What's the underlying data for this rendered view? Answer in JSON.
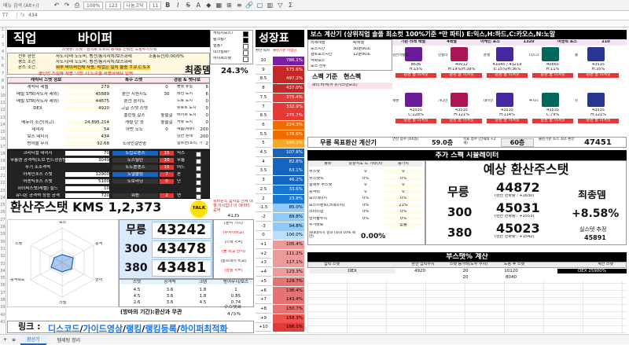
{
  "toolbar": {
    "search": "메뉴 검색 (Alt+/)",
    "zoom": "100%",
    "font": "나눔고딕",
    "size": "11",
    "fmt": "123",
    "undo": "↶",
    "redo": "↷"
  },
  "formula": {
    "ref": "T7",
    "value": "434"
  },
  "tabs": [
    {
      "label": "환산기"
    },
    {
      "label": "템세팅 정리"
    }
  ],
  "left": {
    "job_label": "직업",
    "job_value": "바이퍼",
    "notice1": "스탯창: 스탯 - 임의로 노트피 등재를 선택한 도핑주가스펙",
    "notice_red": "올딘만 스킬뷰 사용 '가능 시 도수을 사용하세요 입력",
    "rows": [
      {
        "k": "전투 환산",
        "v": "사도지/래 노도비, 벵전/통지사치/보스화레",
        "v2": "소통뉴전/0:00/0%"
      },
      {
        "k": "평소 조건",
        "v": "사도지/래 노도비, 벵전/통지사치/보스화레"
      },
      {
        "k": "몬스 조건",
        "v": "뭐부 바이퍼전체 사용, 피업은 일치 불충 ㅎ큐.C.S.X"
      }
    ],
    "stat_head": {
      "a": "캐릭터 스텟 정보",
      "b": "특수 스텟",
      "c": "경험 & 펫나보"
    },
    "stats": [
      {
        "k": "캐릭터 레벨",
        "v": "279",
        "s": "",
        "sv": "0",
        "e": "플랫 쥬얼",
        "ev": "6"
      },
      {
        "k": "메빌 STR(사도자 제외)",
        "v": "45889",
        "s": "분전 지원시도",
        "sv": "30",
        "e": "레전 도시",
        "ev": "6"
      },
      {
        "k": "메빌 STR(사도자 제외)",
        "v": "44675",
        "s": "분전 중시도",
        "sv": "",
        "e": "드로 도시",
        "ev": "0"
      },
      {
        "k": "DEX",
        "v": "4920",
        "s": "고급 스텟 스텟",
        "sv": "",
        "e": "슈뉴트 도시",
        "ev": "0"
      },
      {
        "k": "",
        "v": "",
        "s": "플린링 갈스",
        "sv": "높을길",
        "e": "바이퍼 도시",
        "ev": "0"
      },
      {
        "k": "메뉴이 소건(최고)",
        "v": "24,895,214",
        "s": "캐럴 탄 정",
        "sv": "높을길",
        "e": "커뮤 도시",
        "ev": "0"
      },
      {
        "k": "데미지",
        "v": "54",
        "s": "아반 노도",
        "sv": "0",
        "e": "예름(세뮤)",
        "ev": "200"
      },
      {
        "k": "보스 데미지",
        "v": "434",
        "s": "",
        "sv": "",
        "e": "빈연 혼래",
        "ev": "200"
      },
      {
        "k": "방어율 무시",
        "v": "92.68",
        "s": "도하민걸만중",
        "sv": "",
        "e": "알트연(프리, 기원)",
        "ev": "2"
      }
    ],
    "dark_rows": [
      {
        "k": "크리티컬 데미지",
        "v": "70",
        "s": "노립로렌스",
        "sv": "15",
        "e": "익스",
        "ev": ""
      },
      {
        "k": "무릉렌 공격력(노브 빈드광중방합)",
        "v": "3049",
        "s": "노스틸린",
        "sv": "10",
        "e": "무릉",
        "ev": ""
      },
      {
        "k": "무기 조조격력",
        "v": "",
        "s": "노도뿐렌즈",
        "sv": "15",
        "e": "어드",
        "ev": ""
      },
      {
        "k": "아케인포스 스탯",
        "v": "12900",
        "s": "노델솔링",
        "sv": "7",
        "e": "본",
        "ev": ""
      },
      {
        "k": "어센틱포스 스탯",
        "v": "5100",
        "s": "노보라닝",
        "sv": "0",
        "e": "단",
        "ev": ""
      },
      {
        "k": "하이퍼스탯(레벨) 실드",
        "v": "10",
        "s": "",
        "sv": "",
        "e": "",
        "ev": ""
      },
      {
        "k": "유니온 공격력 상승 공격",
        "v": "720",
        "s": "워동",
        "sv": "2",
        "e": "연",
        "ev": ""
      }
    ],
    "side_top": [
      {
        "k": "캐릭지보스?",
        "v": ""
      },
      {
        "k": "링크링?",
        "v": ""
      },
      {
        "k": "빌용?",
        "v": ""
      },
      {
        "k": "미더밀화?",
        "v": ""
      },
      {
        "k": "하이퍼스탯",
        "v": ""
      }
    ],
    "final_label": "최종뎀",
    "final_value": "24.3%",
    "kms_title": "환산주스탯 KMS 1,2,373",
    "talk": "TALK",
    "side_notice": "뭐바운조 합시험 전제 내 뭘 아시입나 이 데이터 요약",
    "side_val": "4135",
    "radar_labels": [
      "보스",
      "공격",
      "방어",
      "크뎀",
      "공격속도",
      "스텟"
    ],
    "mureung": [
      {
        "k": "무릉",
        "v": "43242"
      },
      {
        "k": "300",
        "v": "43478"
      },
      {
        "k": "380",
        "v": "43481"
      }
    ],
    "mureung_note": [
      "(분석 가치)",
      "(투자이비교)",
      "(스펙 <=)",
      "(둘 비교 한지)",
      "(골프데이 비교)",
      "(당발 <=)"
    ],
    "table_head": [
      "스텟",
      "공격력",
      "크뎀",
      "방어무시/보스"
    ],
    "table_rows": [
      [
        "4.5",
        "3.6",
        "1.8",
        "1"
      ],
      [
        "4.5",
        "3.6",
        "1.8",
        "0.85"
      ],
      [
        "2.6",
        "3.6",
        "4.5",
        "0.74"
      ]
    ],
    "table_sub": [
      "공격력",
      "크뎀",
      "보스"
    ],
    "footer_left": "(방마의 기간):환산과 무관",
    "footer_right_label": "주스탯화",
    "footer_right_val": "475%",
    "link_label": "링크 :",
    "links": [
      {
        "t": "디스코드"
      },
      {
        "t": "가이드영상"
      },
      {
        "t": "랭킹"
      },
      {
        "t": "랭킹등록"
      },
      {
        "t": "하이퍼최적화"
      }
    ]
  },
  "growth": {
    "title": "성장표",
    "col_a": "환산 회차",
    "col_b": "불린기준 피뎀당",
    "rows": [
      {
        "n": "10",
        "v": "786.1%"
      },
      {
        "n": "9",
        "v": "575.6%"
      },
      {
        "n": "8.5",
        "v": "497.2%"
      },
      {
        "n": "8",
        "v": "437.0%"
      },
      {
        "n": "7.5",
        "v": "375.4%"
      },
      {
        "n": "7",
        "v": "332.9%"
      },
      {
        "n": "6.5",
        "v": "275.7%"
      },
      {
        "n": "6",
        "v": "224.3%"
      },
      {
        "n": "5.5",
        "v": "178.6%"
      },
      {
        "n": "5",
        "v": "140.1%"
      },
      {
        "n": "4.5",
        "v": "107.8%"
      },
      {
        "n": "4",
        "v": "82.8%"
      },
      {
        "n": "3.5",
        "v": "63.1%"
      },
      {
        "n": "3",
        "v": "46.2%"
      },
      {
        "n": "2.5",
        "v": "33.6%"
      },
      {
        "n": "2",
        "v": "23.8%"
      },
      {
        "n": "-1.5",
        "v": "85.0%"
      },
      {
        "n": "-2",
        "v": "89.8%"
      },
      {
        "n": "-3",
        "v": "94.8%"
      },
      {
        "n": "0",
        "v": "100.0%"
      },
      {
        "n": "+1",
        "v": "105.4%"
      },
      {
        "n": "+2",
        "v": "111.2%"
      },
      {
        "n": "+3",
        "v": "117.1%"
      },
      {
        "n": "+4",
        "v": "123.3%"
      },
      {
        "n": "+5",
        "v": "129.7%"
      },
      {
        "n": "+6",
        "v": "136.4%"
      },
      {
        "n": "+7",
        "v": "143.4%"
      },
      {
        "n": "+8",
        "v": "150.7%"
      },
      {
        "n": "+9",
        "v": "158.3%"
      },
      {
        "n": "+10",
        "v": "166.1%"
      }
    ]
  },
  "boss": {
    "title": "보스 계산기 (상위직업 솔플 최소컷 100%기준 *만 파티) E:익스,H:하드,C:카오스,N:노말",
    "params": [
      {
        "k": "리레레벨",
        "v": "4/레벨"
      },
      {
        "k": "보스시간",
        "v": "30분00초"
      },
      {
        "k": "검트보스시간",
        "v": "12분00초"
      },
      {
        "k": "약화보스",
        "v": ""
      },
      {
        "k": "보스 전투",
        "v": ""
      }
    ],
    "spec_label": "스펙 기준",
    "spec_value": "현스펙",
    "party_label": "파티 바겨(하 유가스면보조)",
    "cols": [
      "기존 리레 레벨",
      "4레벨",
      "아케인 포스",
      "1320",
      "어센틱 포스",
      "210"
    ],
    "bosses_row1": [
      {
        "name": "검은마법사",
        "hp": "8636",
        "pct": "H:15%"
      },
      {
        "name": "진힐라",
        "hp": "40012",
        "pct": "H:19%/H:38%"
      },
      {
        "name": "듄켈",
        "hp": "41045 / 43219",
        "pct": "E:15%/H:36%"
      },
      {
        "name": "더스크",
        "hp": "40865",
        "pct": "H:11%"
      },
      {
        "name": "윌",
        "hp": "43535",
        "pct": "H:35%"
      }
    ],
    "bosses_row2": [
      {
        "name": "세렌",
        "hp": "43535",
        "pct": "C:128%"
      },
      {
        "name": "가디언",
        "hp": "43535",
        "pct": "H:121%"
      },
      {
        "name": "데미안",
        "hp": "43535",
        "pct": "H:114%"
      },
      {
        "name": "루시드",
        "hp": "43535",
        "pct": "C:79%"
      },
      {
        "name": "진",
        "hp": "43535",
        "pct": "H:121%"
      }
    ],
    "fail_tag": "순환 솔 이겨짓",
    "need_row": {
      "label": "무릉 목표환산 계산기",
      "a": "연산 층수 (XX층)",
      "av": "59.0층",
      "b": "목표 층수 (전재와 +2개)",
      "bv": "60층",
      "c": "불린기준 조스 최소 환산",
      "cv": "47451"
    }
  },
  "sim": {
    "title": "추가 스펙 시뮬레이터",
    "head": [
      "종류",
      "같순지도 드 기타(X)",
      "증가치"
    ],
    "rows": [
      {
        "k": "주스탯",
        "a": "0",
        "b": "0"
      },
      {
        "k": "주스탯%",
        "a": "0%",
        "b": "0%"
      },
      {
        "k": "실제주 주스탯",
        "a": "0",
        "b": "0"
      },
      {
        "k": "공격력",
        "a": "0",
        "b": "0"
      },
      {
        "k": "보스데미지",
        "a": "0%",
        "b": "0%"
      },
      {
        "k": "보스이벤트(크데미지)",
        "a": "0%",
        "b": "21%"
      },
      {
        "k": "크리티컬",
        "a": "0%",
        "b": "0%"
      },
      {
        "k": "방어율무시",
        "a": "0%",
        "b": "0%"
      },
      {
        "k": "추가바로",
        "a": "",
        "b": "없음"
      }
    ],
    "dmg_label": "최대데미지 결과 (최대 10% 제한)",
    "dmg_value": "0.00%",
    "pred_title": "예상 환산주스탯",
    "pred": [
      {
        "k": "무릉",
        "v": "44872",
        "d": "(환산 변화량 : +1630)"
      },
      {
        "k": "300",
        "v": "45031",
        "d": "(환산 변화량 : +1553)"
      },
      {
        "k": "380",
        "v": "45023",
        "d": "(환산 변화량 : +1542)"
      }
    ],
    "final_label": "최종뎀",
    "final_value": "+8.58%",
    "real_label": "실스텟 추정",
    "real_value": "45891"
  },
  "buff": {
    "title": "부스탯% 계산",
    "head": [
      "입력 스탯",
      "",
      "환산 입력수치",
      "스탯 증가비(도수 수치)",
      "도핑 후 스탯",
      "",
      "계산 스탯"
    ],
    "rows": [
      {
        "a": "DEX",
        "b": "4920",
        "c": "20",
        "d": "10120",
        "e": "DEX 25900%"
      },
      {
        "a": "",
        "b": "",
        "c": "20",
        "d": "8040",
        "e": ""
      }
    ]
  }
}
